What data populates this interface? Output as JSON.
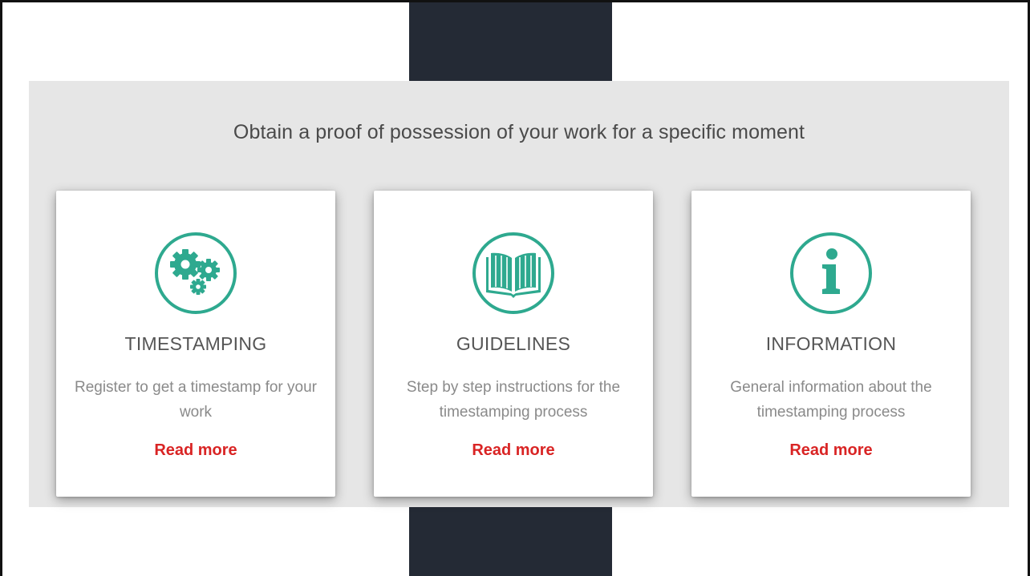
{
  "section": {
    "headline": "Obtain a proof of possession of your work for a specific moment"
  },
  "cards": [
    {
      "icon": "gears-icon",
      "title": "TIMESTAMPING",
      "description": "Register to get a timestamp for your work",
      "link_label": "Read more"
    },
    {
      "icon": "open-book-icon",
      "title": "GUIDELINES",
      "description": "Step by step instructions for the timestamping process",
      "link_label": "Read more"
    },
    {
      "icon": "info-icon",
      "title": "INFORMATION",
      "description": "General information about the timestamping process",
      "link_label": "Read more"
    }
  ],
  "colors": {
    "accent": "#2ea98f",
    "link": "#d92424",
    "band_background": "#e6e6e6",
    "dark_bar": "#242a35"
  }
}
